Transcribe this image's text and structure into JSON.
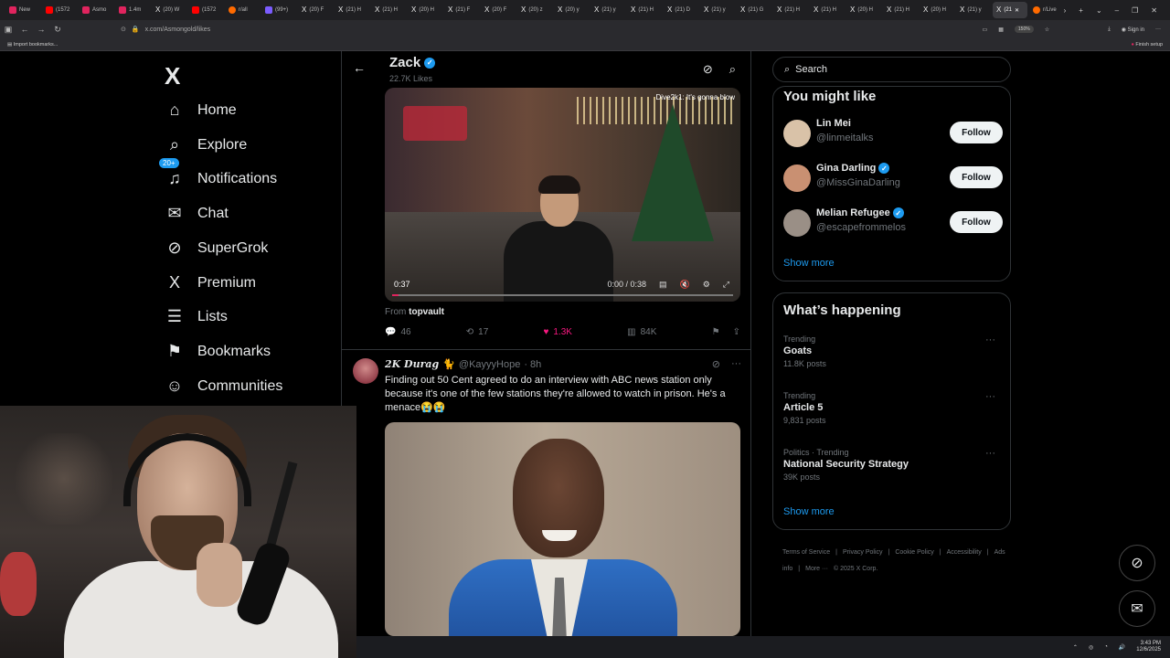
{
  "browser": {
    "tabs": [
      {
        "label": "New",
        "icon": "red"
      },
      {
        "label": "(1572",
        "icon": "yt"
      },
      {
        "label": "Asmo",
        "icon": "red"
      },
      {
        "label": "1.4m",
        "icon": "red"
      },
      {
        "label": "(20) W",
        "icon": "x"
      },
      {
        "label": "(1572",
        "icon": "yt"
      },
      {
        "label": "r/all",
        "icon": "orange"
      },
      {
        "label": "(99+)",
        "icon": "purple"
      },
      {
        "label": "(20) F",
        "icon": "x"
      },
      {
        "label": "(21) H",
        "icon": "x"
      },
      {
        "label": "(21) H",
        "icon": "x"
      },
      {
        "label": "(20) H",
        "icon": "x"
      },
      {
        "label": "(21) F",
        "icon": "x"
      },
      {
        "label": "(20) F",
        "icon": "x"
      },
      {
        "label": "(20) z",
        "icon": "x"
      },
      {
        "label": "(20) y",
        "icon": "x"
      },
      {
        "label": "(21) y",
        "icon": "x"
      },
      {
        "label": "(21) H",
        "icon": "x"
      },
      {
        "label": "(21) D",
        "icon": "x"
      },
      {
        "label": "(21) y",
        "icon": "x"
      },
      {
        "label": "(21) G",
        "icon": "x"
      },
      {
        "label": "(21) H",
        "icon": "x"
      },
      {
        "label": "(21) H",
        "icon": "x"
      },
      {
        "label": "(20) H",
        "icon": "x"
      },
      {
        "label": "(21) H",
        "icon": "x"
      },
      {
        "label": "(20) H",
        "icon": "x"
      },
      {
        "label": "(21) y",
        "icon": "x"
      },
      {
        "label": "(21",
        "icon": "x",
        "active": true
      },
      {
        "label": "r/Live",
        "icon": "orange"
      }
    ],
    "url": "x.com/Asmongold/likes",
    "zoom": "150%",
    "sign_in": "Sign in",
    "import_bookmarks": "Import bookmarks...",
    "finish_setup": "Finish setup"
  },
  "nav": {
    "logo": "X",
    "items": [
      {
        "label": "Home",
        "icon": "home-icon",
        "glyph": "⌂"
      },
      {
        "label": "Explore",
        "icon": "search-icon",
        "glyph": "⌕"
      },
      {
        "label": "Notifications",
        "icon": "bell-icon",
        "glyph": "♫",
        "badge": "20+"
      },
      {
        "label": "Chat",
        "icon": "mail-icon",
        "glyph": "✉"
      },
      {
        "label": "SuperGrok",
        "icon": "grok-icon",
        "glyph": "⊘"
      },
      {
        "label": "Premium",
        "icon": "x-logo-icon",
        "glyph": "X"
      },
      {
        "label": "Lists",
        "icon": "list-icon",
        "glyph": "☰"
      },
      {
        "label": "Bookmarks",
        "icon": "bookmark-icon",
        "glyph": "⚑"
      },
      {
        "label": "Communities",
        "icon": "people-icon",
        "glyph": "☺"
      }
    ]
  },
  "header": {
    "name": "Zack",
    "likes": "22.7K Likes"
  },
  "post1": {
    "video_time": "0:37",
    "video_progress": "0:00 / 0:38",
    "video_overlay": "Dive2k1: It's gonna blow",
    "progress_fraction": 0.02,
    "from_label": "From",
    "from_source": "topvault",
    "replies": "46",
    "reposts": "17",
    "likes": "1.3K",
    "views": "84K"
  },
  "post2": {
    "name": "2K Durag",
    "badge_glyph": "🐈",
    "handle": "@KayyyHope",
    "time": "· 8h",
    "text": "Finding out 50 Cent agreed to do an interview with ABC news station only because it's one of the few stations they're allowed to watch in prison. He's a menace😭😭"
  },
  "right": {
    "search_placeholder": "Search",
    "might_like_title": "You might like",
    "suggestions": [
      {
        "name": "Lin Mei",
        "handle": "@linmeitalks",
        "verified": false,
        "avatar_color": "#d9c2a8"
      },
      {
        "name": "Gina Darling",
        "handle": "@MissGinaDarling",
        "verified": true,
        "avatar_color": "#c99072"
      },
      {
        "name": "Melian Refugee",
        "handle": "@escapefrommelos",
        "verified": true,
        "avatar_color": "#9a8f86"
      }
    ],
    "follow_label": "Follow",
    "show_more": "Show more",
    "happening_title": "What’s happening",
    "trends": [
      {
        "category": "Trending",
        "name": "Goats",
        "posts": "11.8K posts"
      },
      {
        "category": "Trending",
        "name": "Article 5",
        "posts": "9,831 posts"
      },
      {
        "category": "Politics · Trending",
        "name": "National Security Strategy",
        "posts": "39K posts"
      }
    ],
    "footer": [
      "Terms of Service",
      "|",
      "Privacy Policy",
      "|",
      "Cookie Policy",
      "|",
      "Accessibility",
      "|",
      "Ads info",
      "|",
      "More ···",
      "© 2025 X Corp."
    ]
  },
  "taskbar": {
    "time": "3:43 PM",
    "date": "12/6/2025"
  },
  "colors": {
    "accent": "#1d9bf0",
    "like": "#f91880",
    "background": "#000000"
  }
}
